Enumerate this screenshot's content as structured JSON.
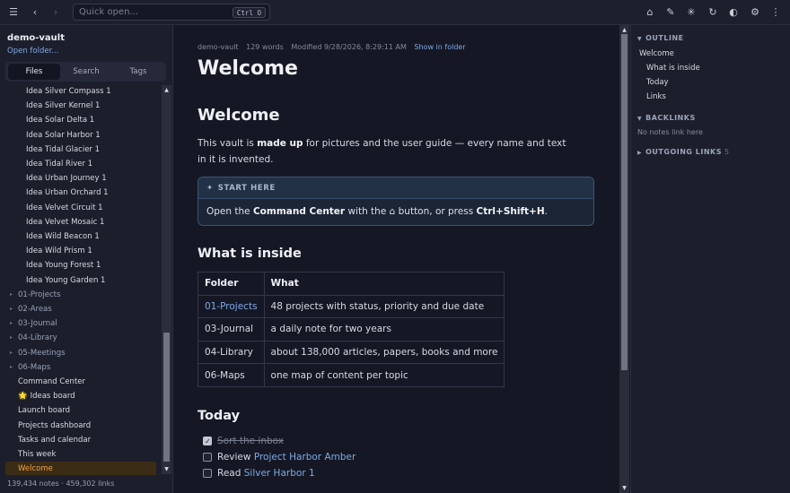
{
  "topbar": {
    "quick_open_placeholder": "Quick open...",
    "shortcut": "Ctrl O",
    "icons": [
      "menu-icon",
      "back-icon",
      "forward-icon",
      "home-icon",
      "pen-icon",
      "sparkle-icon",
      "refresh-icon",
      "theme-icon",
      "settings-icon",
      "more-icon"
    ]
  },
  "sidebar": {
    "vault_name": "demo-vault",
    "open_folder": "Open folder...",
    "tabs": [
      "Files",
      "Search",
      "Tags"
    ],
    "active_tab": "Files",
    "tree": [
      {
        "label": "Idea Silver Compass 1",
        "type": "file"
      },
      {
        "label": "Idea Silver Kernel 1",
        "type": "file"
      },
      {
        "label": "Idea Solar Delta 1",
        "type": "file"
      },
      {
        "label": "Idea Solar Harbor 1",
        "type": "file"
      },
      {
        "label": "Idea Tidal Glacier 1",
        "type": "file"
      },
      {
        "label": "Idea Tidal River 1",
        "type": "file"
      },
      {
        "label": "Idea Urban Journey 1",
        "type": "file"
      },
      {
        "label": "Idea Urban Orchard 1",
        "type": "file"
      },
      {
        "label": "Idea Velvet Circuit 1",
        "type": "file"
      },
      {
        "label": "Idea Velvet Mosaic 1",
        "type": "file"
      },
      {
        "label": "Idea Wild Beacon 1",
        "type": "file"
      },
      {
        "label": "Idea Wild Prism 1",
        "type": "file"
      },
      {
        "label": "Idea Young Forest 1",
        "type": "file"
      },
      {
        "label": "Idea Young Garden 1",
        "type": "file"
      },
      {
        "label": "01-Projects",
        "type": "folder"
      },
      {
        "label": "02-Areas",
        "type": "folder"
      },
      {
        "label": "03-Journal",
        "type": "folder"
      },
      {
        "label": "04-Library",
        "type": "folder"
      },
      {
        "label": "05-Meetings",
        "type": "folder"
      },
      {
        "label": "06-Maps",
        "type": "folder"
      },
      {
        "label": "Command Center",
        "type": "root"
      },
      {
        "label": "Ideas board",
        "type": "root",
        "emoji": "🌟"
      },
      {
        "label": "Launch board",
        "type": "root"
      },
      {
        "label": "Projects dashboard",
        "type": "root"
      },
      {
        "label": "Tasks and calendar",
        "type": "root"
      },
      {
        "label": "This week",
        "type": "root"
      },
      {
        "label": "Welcome",
        "type": "root",
        "active": true
      }
    ],
    "stats": "139,434 notes · 459,302 links"
  },
  "doc": {
    "meta": {
      "vault": "demo-vault",
      "words": "129 words",
      "modified": "Modified 9/28/2026, 8:29:11 AM",
      "show_in_folder": "Show in folder"
    },
    "title": "Welcome",
    "h1": "Welcome",
    "intro": {
      "pre": "This vault is ",
      "bold": "made up",
      "post": " for pictures and the user guide — every name and text in it is invented."
    },
    "callout": {
      "title": "START HERE",
      "pre": "Open the ",
      "bold1": "Command Center",
      "mid": " with the ⌂ button, or press ",
      "bold2": "Ctrl+Shift+H",
      "post": "."
    },
    "section_inside": "What is inside",
    "table": {
      "headers": [
        "Folder",
        "What"
      ],
      "rows": [
        {
          "folder": "01-Projects",
          "what": "48 projects with status, priority and due date",
          "link": true
        },
        {
          "folder": "03-Journal",
          "what": "a daily note for two years",
          "link": false
        },
        {
          "folder": "04-Library",
          "what": "about 138,000 articles, papers, books and more",
          "link": false
        },
        {
          "folder": "06-Maps",
          "what": "one map of content per topic",
          "link": false
        }
      ]
    },
    "section_today": "Today",
    "tasks": [
      {
        "text": "Sort the inbox",
        "done": true
      },
      {
        "pre": "Review ",
        "link": "Project Harbor Amber",
        "done": false
      },
      {
        "pre": "Read ",
        "link": "Silver Harbor 1",
        "done": false
      }
    ]
  },
  "right_panel": {
    "outline_title": "OUTLINE",
    "outline": [
      {
        "label": "Welcome",
        "level": 1
      },
      {
        "label": "What is inside",
        "level": 2
      },
      {
        "label": "Today",
        "level": 2
      },
      {
        "label": "Links",
        "level": 2
      }
    ],
    "backlinks_title": "BACKLINKS",
    "backlinks_empty": "No notes link here",
    "outgoing_title": "OUTGOING LINKS",
    "outgoing_count": "5"
  }
}
